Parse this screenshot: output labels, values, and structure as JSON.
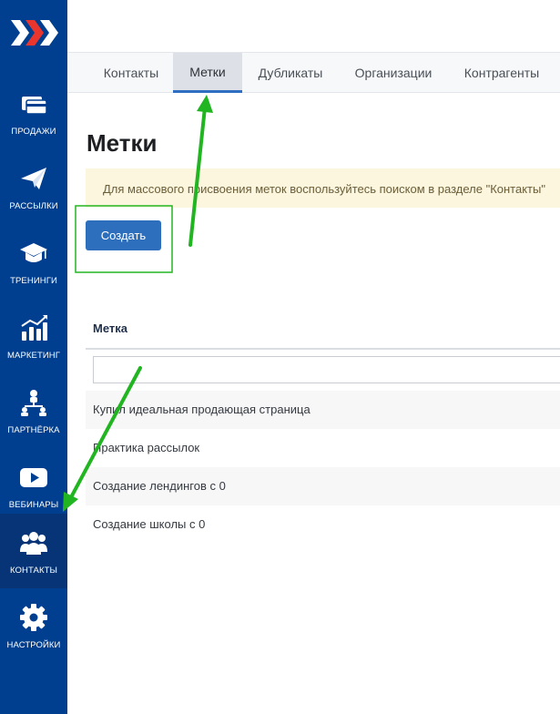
{
  "sidebar": {
    "items": [
      {
        "label": "ПРОДАЖИ",
        "icon": "credit-cards-icon"
      },
      {
        "label": "РАССЫЛКИ",
        "icon": "paper-plane-icon"
      },
      {
        "label": "ТРЕНИНГИ",
        "icon": "graduation-cap-icon"
      },
      {
        "label": "МАРКЕТИНГ",
        "icon": "growth-chart-icon"
      },
      {
        "label": "ПАРТНЁРКА",
        "icon": "network-people-icon"
      },
      {
        "label": "ВЕБИНАРЫ",
        "icon": "play-button-icon"
      },
      {
        "label": "КОНТАКТЫ",
        "icon": "users-icon",
        "active": true
      },
      {
        "label": "НАСТРОЙКИ",
        "icon": "gear-icon"
      }
    ]
  },
  "tabs": [
    {
      "label": "Контакты"
    },
    {
      "label": "Метки",
      "active": true
    },
    {
      "label": "Дубликаты"
    },
    {
      "label": "Организации"
    },
    {
      "label": "Контрагенты"
    }
  ],
  "page": {
    "title": "Метки",
    "notice": "Для массового присвоения меток воспользуйтесь поиском в разделе \"Контакты\"",
    "create_label": "Создать"
  },
  "table": {
    "column": "Метка",
    "filter_placeholder": "",
    "rows": [
      "Купил идеальная продающая страница",
      "Практика рассылок",
      "Создание лендингов с 0",
      "Создание школы с 0"
    ]
  },
  "colors": {
    "sidebar": "#003f8f",
    "accent": "#2d6fbd",
    "annotation": "#22b522"
  }
}
